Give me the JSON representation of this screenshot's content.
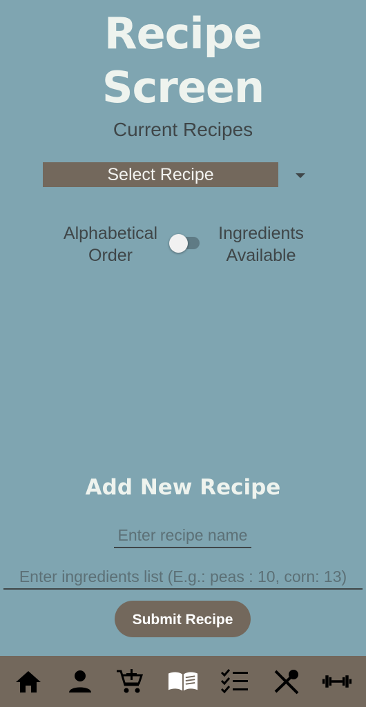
{
  "header": {
    "title_line1": "Recipe",
    "title_line2": "Screen",
    "subtitle": "Current Recipes"
  },
  "recipe_select": {
    "selected": "Select Recipe"
  },
  "sort_toggle": {
    "left_line1": "Alphabetical",
    "left_line2": "Order",
    "right_line1": "Ingredients",
    "right_line2": "Available",
    "state": "off"
  },
  "add_section": {
    "title": "Add New Recipe",
    "name_placeholder": "Enter recipe name",
    "ingredients_placeholder": "Enter ingredients list (E.g.: peas : 10, corn: 13)",
    "submit_label": "Submit Recipe"
  },
  "nav": {
    "items": [
      "home-icon",
      "person-icon",
      "add-cart-icon",
      "book-icon",
      "checklist-icon",
      "utensils-icon",
      "dumbbell-icon"
    ]
  },
  "colors": {
    "background": "#7fa5b1",
    "accent": "#73685c",
    "title": "#eef3ee",
    "text": "#3f4648"
  }
}
